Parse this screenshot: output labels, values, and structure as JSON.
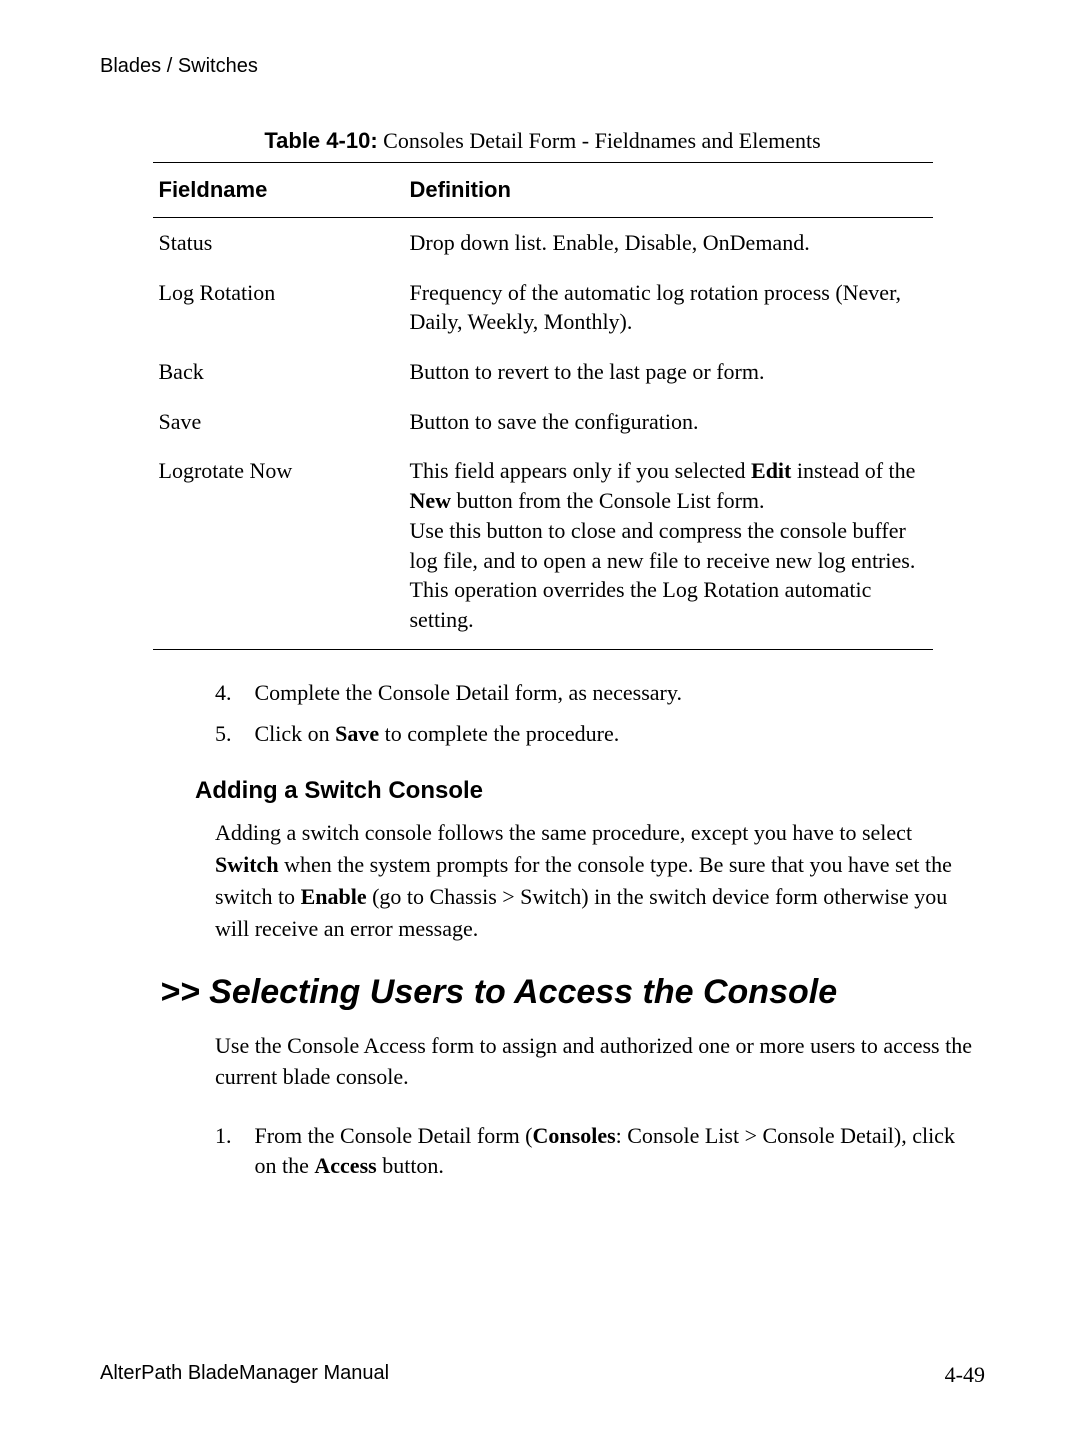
{
  "header": {
    "running": "Blades / Switches"
  },
  "table": {
    "caption_bold": "Table 4-10:",
    "caption_rest": " Consoles Detail Form - Fieldnames and Elements",
    "head": {
      "c1": "Fieldname",
      "c2": "Definition"
    },
    "rows": [
      {
        "field": "Status",
        "def": "Drop down list. Enable, Disable, OnDemand."
      },
      {
        "field": "Log Rotation",
        "def": "Frequency of the automatic log rotation process (Never, Daily, Weekly, Monthly)."
      },
      {
        "field": "Back",
        "def": "Button to revert to the last page or form."
      },
      {
        "field": "Save",
        "def": "Button to save the configuration."
      },
      {
        "field": "Logrotate Now",
        "def_parts": {
          "p1a": "This field appears only if you selected ",
          "p1b": "Edit",
          "p1c": " instead of the ",
          "p1d": "New",
          "p1e": " button from the Console List form.",
          "p2": "Use this button to close and compress the console buffer log file, and to open a new file to receive new log entries. This operation overrides the Log Rotation automatic setting."
        }
      }
    ]
  },
  "steps_a": {
    "s4n": "4.",
    "s4t": "Complete the Console Detail form, as necessary.",
    "s5n": "5.",
    "s5a": "Click on ",
    "s5b": "Save",
    "s5c": " to complete the procedure."
  },
  "h3": "Adding a Switch Console",
  "para1": {
    "a": "Adding a switch console follows the same procedure, except you have to select ",
    "b": "Switch",
    "c": " when the system prompts for the console type. Be sure that you have set the switch to ",
    "d": "Enable",
    "e": " (go to Chassis > Switch) in the switch device form otherwise you will receive an error message."
  },
  "h2": ">> Selecting Users to Access the Console",
  "para2": "Use the Console Access form to assign and authorized one or more users to access the current blade console.",
  "steps_b": {
    "s1n": "1.",
    "s1": {
      "a": "From the Console Detail form (",
      "b": "Consoles",
      "c": ": Console List > Console Detail), click on the ",
      "d": "Access",
      "e": " button."
    }
  },
  "footer": {
    "left": "AlterPath BladeManager Manual",
    "right": "4-49"
  }
}
